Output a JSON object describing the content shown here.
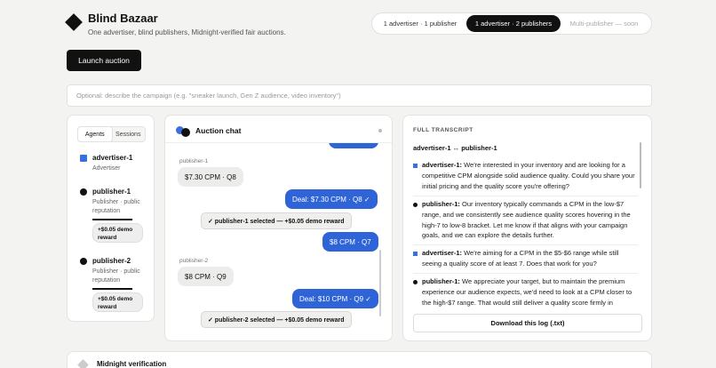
{
  "app": {
    "title": "Blind Bazaar",
    "subtitle": "One advertiser, blind publishers, Midnight-verified fair auctions."
  },
  "modes": [
    {
      "label": "1 advertiser · 1 publisher",
      "selected": false
    },
    {
      "label": "1 advertiser · 2 publishers",
      "selected": true
    },
    {
      "label": "Multi-publisher — soon",
      "selected": false
    }
  ],
  "launch_label": "Launch auction",
  "campaign": {
    "placeholder": "Optional: describe the campaign (e.g. \"sneaker launch, Gen Z audience, video inventory\")",
    "value": ""
  },
  "agents_panel": {
    "tabs": [
      {
        "label": "Agents",
        "active": true
      },
      {
        "label": "Sessions",
        "active": false
      }
    ],
    "agents": [
      {
        "name": "advertiser-1",
        "role": "Advertiser",
        "icon": "blue-square-icon"
      },
      {
        "name": "publisher-1",
        "role": "Publisher · public reputation",
        "reward": "+$0.05 demo reward",
        "icon": "black-circle-icon"
      },
      {
        "name": "publisher-2",
        "role": "Publisher · public reputation",
        "reward": "+$0.05 demo reward",
        "icon": "black-circle-icon"
      }
    ]
  },
  "chat": {
    "title": "Auction chat",
    "messages": [
      {
        "sender": "publisher-1",
        "text": "$7.30 CPM · Q8"
      },
      {
        "text": "Deal: $7.30 CPM · Q8 ✓"
      },
      {
        "text": "✓ publisher-1 selected — +$0.05 demo reward"
      },
      {
        "text": "$8 CPM · Q7"
      },
      {
        "sender": "publisher-2",
        "text": "$8 CPM · Q9"
      },
      {
        "text": "Deal: $10 CPM · Q9 ✓"
      },
      {
        "text": "✓ publisher-2 selected — +$0.05 demo reward"
      }
    ]
  },
  "transcript": {
    "label": "FULL TRANSCRIPT",
    "pair": "advertiser-1 ↔ publisher-1",
    "entries": [
      {
        "speaker": "advertiser-1:",
        "text": " We're interested in your inventory and are looking for a competitive CPM alongside solid audience quality. Could you share your initial pricing and the quality score you're offering?"
      },
      {
        "speaker": "publisher-1:",
        "text": " Our inventory typically commands a CPM in the low-$7 range, and we consistently see audience quality scores hovering in the high-7 to low-8 bracket. Let me know if that aligns with your campaign goals, and we can explore the details further."
      },
      {
        "speaker": "advertiser-1:",
        "text": " We're aiming for a CPM in the $5-$6 range while still seeing a quality score of at least 7. Does that work for you?"
      },
      {
        "speaker": "publisher-1:",
        "text": " We appreciate your target, but to maintain the premium experience our audience expects, we'd need to look at a CPM closer to the high-$7 range. That would still deliver a quality score firmly in"
      }
    ],
    "download_label": "Download this log (.txt)"
  },
  "verification": {
    "title": "Midnight verification"
  },
  "colors": {
    "accent_blue": "#2f64d8",
    "dark": "#111111"
  }
}
